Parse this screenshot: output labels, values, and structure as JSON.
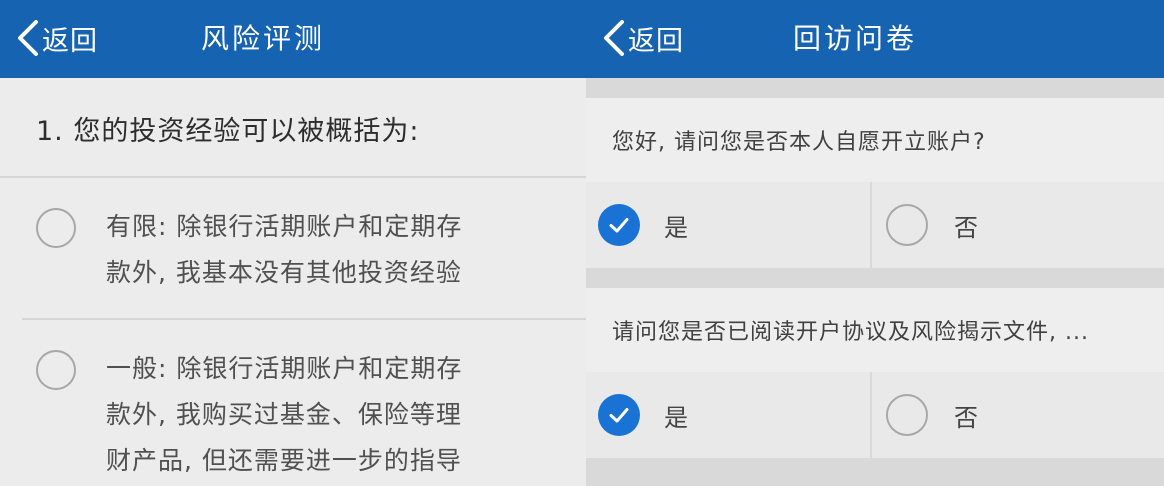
{
  "colors": {
    "navbar": "#1563b1",
    "check_selected": "#1a73d4",
    "radio_border": "#a7a7a7"
  },
  "left_screen": {
    "back_label": "返回",
    "title": "风险评测",
    "question": "1. 您的投资经验可以被概括为:",
    "options": [
      {
        "lines": [
          "有限: 除银行活期账户和定期存",
          "款外, 我基本没有其他投资经验"
        ],
        "selected": false
      },
      {
        "lines": [
          "一般: 除银行活期账户和定期存",
          "款外, 我购买过基金、保险等理",
          "财产品, 但还需要进一步的指导"
        ],
        "selected": false
      }
    ]
  },
  "right_screen": {
    "back_label": "返回",
    "title": "回访问卷",
    "questions": [
      {
        "text": "您好, 请问您是否本人自愿开立账户?",
        "yes_label": "是",
        "no_label": "否",
        "selected": "yes"
      },
      {
        "text": "请问您是否已阅读开户协议及风险揭示文件, ...",
        "yes_label": "是",
        "no_label": "否",
        "selected": "yes"
      }
    ]
  }
}
